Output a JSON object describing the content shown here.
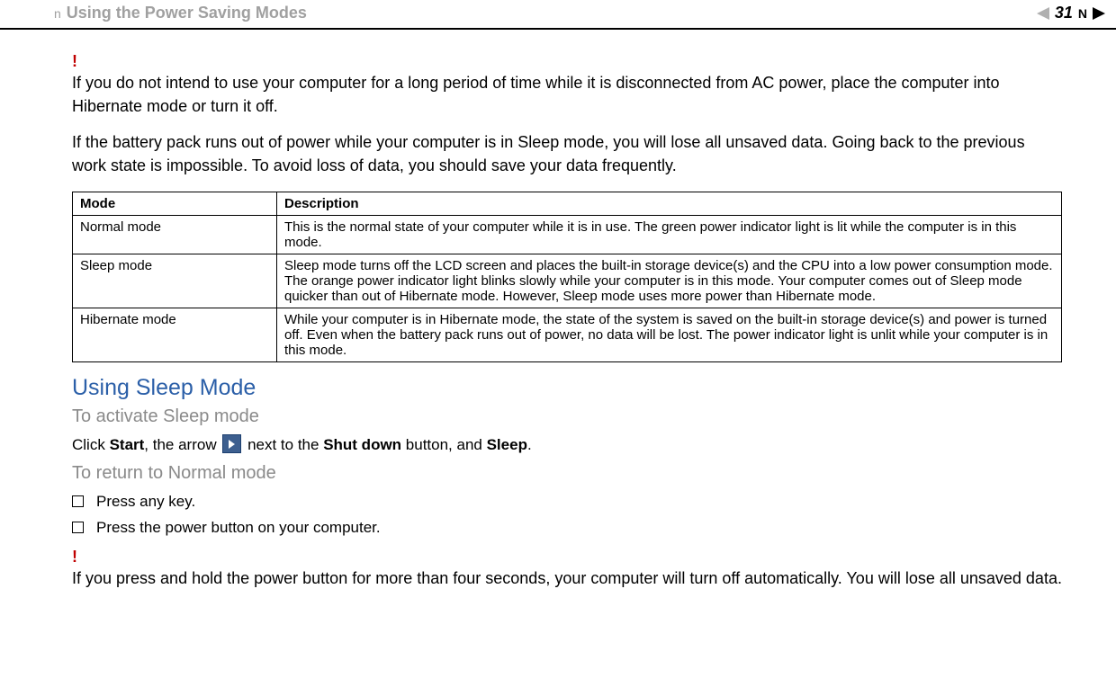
{
  "header": {
    "title": "Using the Power Saving Modes",
    "page_number": "31",
    "label_n": "n",
    "label_N": "N"
  },
  "warn1": {
    "mark": "!",
    "p1": "If you do not intend to use your computer for a long period of time while it is disconnected from AC power, place the computer into Hibernate mode or turn it off.",
    "p2": "If the battery pack runs out of power while your computer is in Sleep mode, you will lose all unsaved data. Going back to the previous work state is impossible. To avoid loss of data, you should save your data frequently."
  },
  "table": {
    "headers": {
      "mode": "Mode",
      "desc": "Description"
    },
    "rows": [
      {
        "mode": "Normal mode",
        "desc": "This is the normal state of your computer while it is in use. The green power indicator light is lit while the computer is in this mode."
      },
      {
        "mode": "Sleep mode",
        "desc": "Sleep mode turns off the LCD screen and places the built-in storage device(s) and the CPU into a low power consumption mode. The orange power indicator light blinks slowly while your computer is in this mode. Your computer comes out of Sleep mode quicker than out of Hibernate mode. However, Sleep mode uses more power than Hibernate mode."
      },
      {
        "mode": "Hibernate mode",
        "desc": "While your computer is in Hibernate mode, the state of the system is saved on the built-in storage device(s) and power is turned off. Even when the battery pack runs out of power, no data will be lost. The power indicator light is unlit while your computer is in this mode."
      }
    ]
  },
  "section": {
    "h": "Using Sleep Mode",
    "sub1": "To activate Sleep mode",
    "instr": {
      "pre": "Click ",
      "start": "Start",
      "mid1": ", the arrow ",
      "mid2": " next to the ",
      "shutdown": "Shut down",
      "mid3": " button, and ",
      "sleep": "Sleep",
      "end": "."
    },
    "sub2": "To return to Normal mode",
    "bullets": [
      "Press any key.",
      "Press the power button on your computer."
    ]
  },
  "warn2": {
    "mark": "!",
    "p": "If you press and hold the power button for more than four seconds, your computer will turn off automatically. You will lose all unsaved data."
  }
}
